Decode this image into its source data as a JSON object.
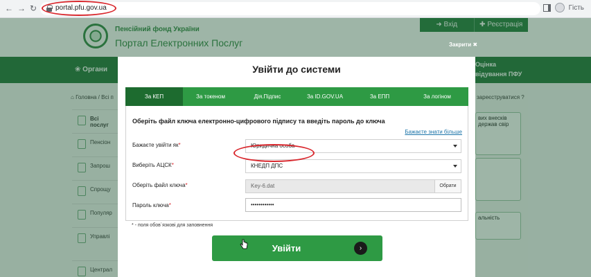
{
  "browser": {
    "url": "portal.pfu.gov.ua",
    "profile_label": "Гість"
  },
  "page": {
    "org_name": "Пенсійний фонд України",
    "portal_title": "Портал Електронних Послуг",
    "login_tab_label": "Вхід",
    "register_tab_label": "Реєстрація",
    "close_label": "Закрити",
    "close_glyph": "✖",
    "menu_organs": "Органи",
    "menu_right_lines": [
      "Оцінка",
      "відування ПФУ"
    ],
    "breadcrumb": "Головна / Всі п",
    "register_hint": "зареєструватися",
    "sidebar": [
      "Всі послуг",
      "Пенсіон",
      "Запрош",
      "Спрощу",
      "Популяр",
      "Управлі",
      "Централ"
    ],
    "cards": [
      "вих внесків держав свір",
      "",
      "альність"
    ]
  },
  "modal": {
    "title": "Увійти до системи",
    "tabs": [
      "За КЕП",
      "За токеном",
      "Дія.Підпис",
      "За ID.GOV.UA",
      "За ЕПП",
      "За логіном"
    ],
    "active_tab": 0,
    "heading": "Оберіть файл ключа електронно-цифрового підпису та введіть пароль до ключа",
    "learn_more": "Бажаєте знати більше",
    "fields": {
      "login_as": {
        "label": "Бажаєте увійти як",
        "value": "Юридична особа"
      },
      "acsk": {
        "label": "Виберіть АЦСК",
        "value": "КНЕДП ДПС"
      },
      "key_file": {
        "label": "Оберіть файл ключа",
        "value": "Key-6.dat",
        "button": "Обрати"
      },
      "password": {
        "label": "Пароль ключа",
        "value": "••••••••••••"
      }
    },
    "required_mark": "*",
    "required_note": "* - поля обов`язкові для заповнення",
    "submit_label": "Увійти",
    "submit_arrow": "›"
  },
  "colors": {
    "brand_green": "#2e9a44",
    "dark_green": "#1d6b2f",
    "annotation_red": "#d9262c"
  }
}
